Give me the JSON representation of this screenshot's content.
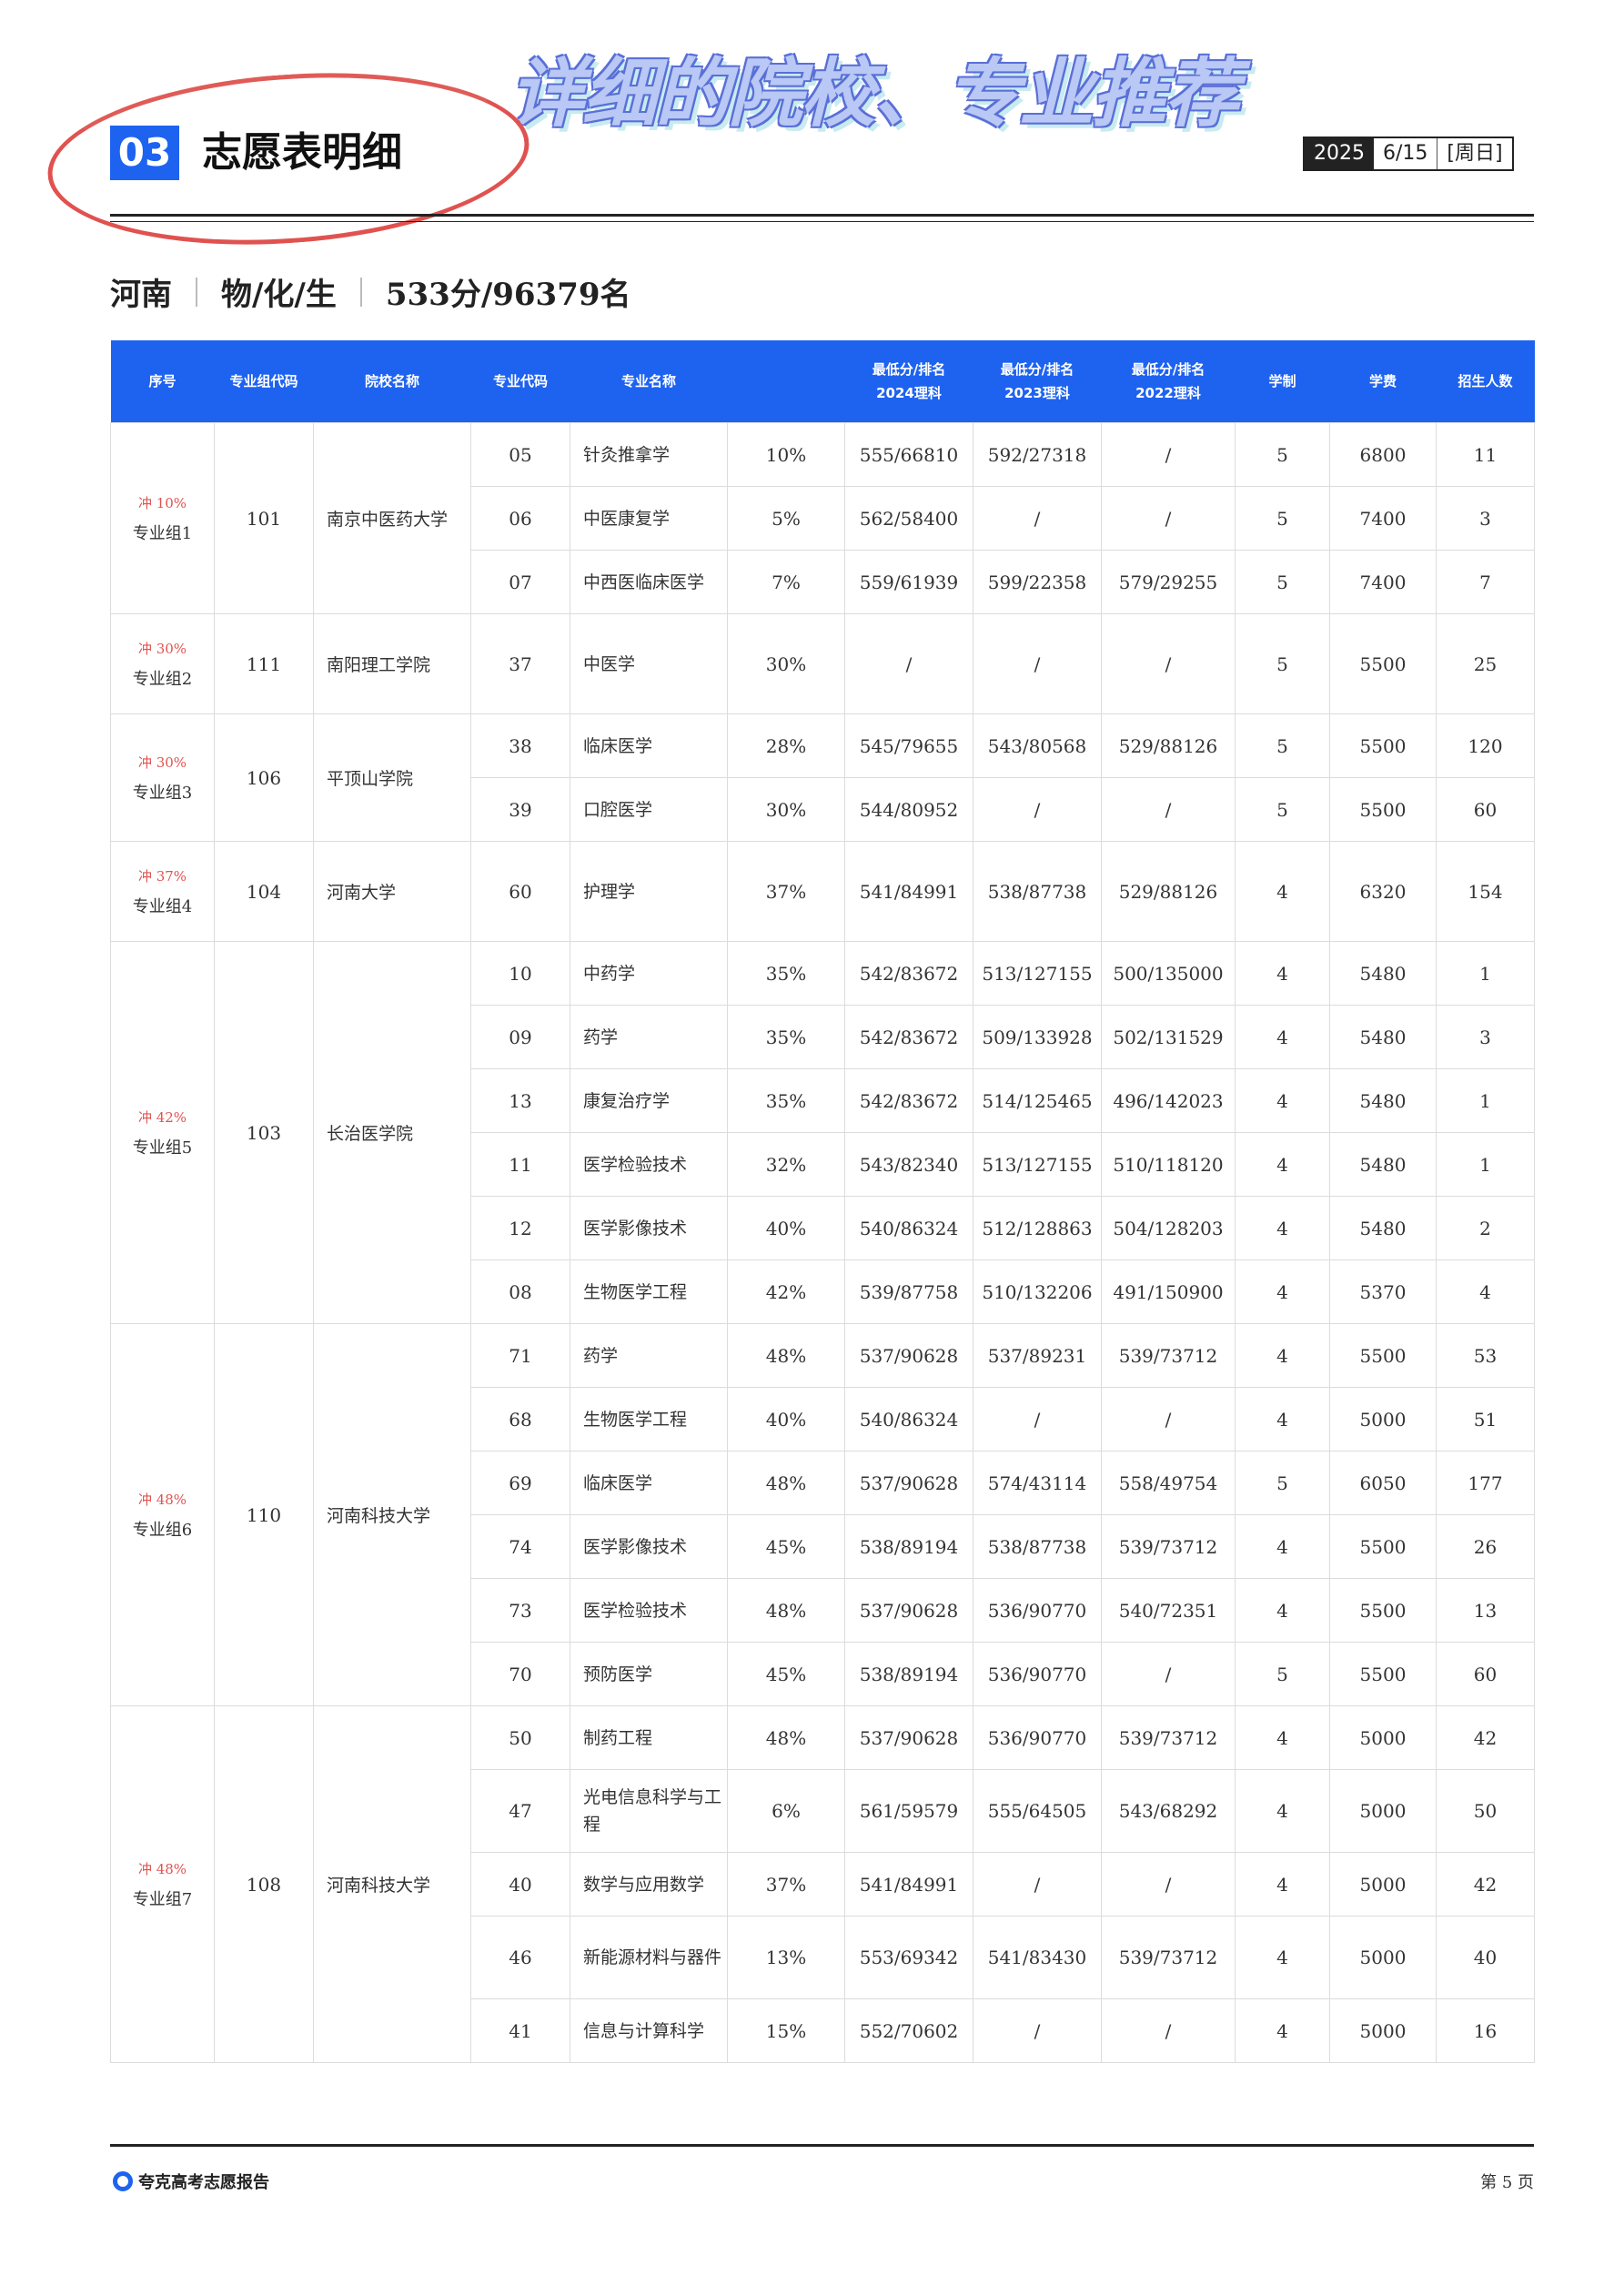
{
  "banner": "详细的院校、专业推荐",
  "section": {
    "number": "03",
    "title": "志愿表明细"
  },
  "date": {
    "year": "2025",
    "month_day": "6/15",
    "weekday": "[周日]"
  },
  "meta": {
    "province": "河南",
    "subjects": "物/化/生",
    "score_rank": "533分/96379名"
  },
  "table": {
    "headers": [
      "序号",
      "专业组代码",
      "院校名称",
      "专业代码",
      "专业名称",
      "",
      "最低分/排名\n2024理科",
      "最低分/排名\n2023理科",
      "最低分/排名\n2022理科",
      "学制",
      "学费",
      "招生人数"
    ],
    "groups": [
      {
        "tag": "冲 10%",
        "name": "专业组1",
        "code": "101",
        "school": "南京中医药大学",
        "rows": [
          [
            "05",
            "针灸推拿学",
            "10%",
            "555/66810",
            "592/27318",
            "/",
            "5",
            "6800",
            "11"
          ],
          [
            "06",
            "中医康复学",
            "5%",
            "562/58400",
            "/",
            "/",
            "5",
            "7400",
            "3"
          ],
          [
            "07",
            "中西医临床医学",
            "7%",
            "559/61939",
            "599/22358",
            "579/29255",
            "5",
            "7400",
            "7"
          ]
        ]
      },
      {
        "tag": "冲 30%",
        "name": "专业组2",
        "code": "111",
        "school": "南阳理工学院",
        "rows": [
          [
            "37",
            "中医学",
            "30%",
            "/",
            "/",
            "/",
            "5",
            "5500",
            "25"
          ]
        ]
      },
      {
        "tag": "冲 30%",
        "name": "专业组3",
        "code": "106",
        "school": "平顶山学院",
        "rows": [
          [
            "38",
            "临床医学",
            "28%",
            "545/79655",
            "543/80568",
            "529/88126",
            "5",
            "5500",
            "120"
          ],
          [
            "39",
            "口腔医学",
            "30%",
            "544/80952",
            "/",
            "/",
            "5",
            "5500",
            "60"
          ]
        ]
      },
      {
        "tag": "冲 37%",
        "name": "专业组4",
        "code": "104",
        "school": "河南大学",
        "rows": [
          [
            "60",
            "护理学",
            "37%",
            "541/84991",
            "538/87738",
            "529/88126",
            "4",
            "6320",
            "154"
          ]
        ]
      },
      {
        "tag": "冲 42%",
        "name": "专业组5",
        "code": "103",
        "school": "长治医学院",
        "rows": [
          [
            "10",
            "中药学",
            "35%",
            "542/83672",
            "513/127155",
            "500/135000",
            "4",
            "5480",
            "1"
          ],
          [
            "09",
            "药学",
            "35%",
            "542/83672",
            "509/133928",
            "502/131529",
            "4",
            "5480",
            "3"
          ],
          [
            "13",
            "康复治疗学",
            "35%",
            "542/83672",
            "514/125465",
            "496/142023",
            "4",
            "5480",
            "1"
          ],
          [
            "11",
            "医学检验技术",
            "32%",
            "543/82340",
            "513/127155",
            "510/118120",
            "4",
            "5480",
            "1"
          ],
          [
            "12",
            "医学影像技术",
            "40%",
            "540/86324",
            "512/128863",
            "504/128203",
            "4",
            "5480",
            "2"
          ],
          [
            "08",
            "生物医学工程",
            "42%",
            "539/87758",
            "510/132206",
            "491/150900",
            "4",
            "5370",
            "4"
          ]
        ]
      },
      {
        "tag": "冲 48%",
        "name": "专业组6",
        "code": "110",
        "school": "河南科技大学",
        "rows": [
          [
            "71",
            "药学",
            "48%",
            "537/90628",
            "537/89231",
            "539/73712",
            "4",
            "5500",
            "53"
          ],
          [
            "68",
            "生物医学工程",
            "40%",
            "540/86324",
            "/",
            "/",
            "4",
            "5000",
            "51"
          ],
          [
            "69",
            "临床医学",
            "48%",
            "537/90628",
            "574/43114",
            "558/49754",
            "5",
            "6050",
            "177"
          ],
          [
            "74",
            "医学影像技术",
            "45%",
            "538/89194",
            "538/87738",
            "539/73712",
            "4",
            "5500",
            "26"
          ],
          [
            "73",
            "医学检验技术",
            "48%",
            "537/90628",
            "536/90770",
            "540/72351",
            "4",
            "5500",
            "13"
          ],
          [
            "70",
            "预防医学",
            "45%",
            "538/89194",
            "536/90770",
            "/",
            "5",
            "5500",
            "60"
          ]
        ]
      },
      {
        "tag": "冲 48%",
        "name": "专业组7",
        "code": "108",
        "school": "河南科技大学",
        "rows": [
          [
            "50",
            "制药工程",
            "48%",
            "537/90628",
            "536/90770",
            "539/73712",
            "4",
            "5000",
            "42"
          ],
          [
            "47",
            "光电信息科学与工程",
            "6%",
            "561/59579",
            "555/64505",
            "543/68292",
            "4",
            "5000",
            "50"
          ],
          [
            "40",
            "数学与应用数学",
            "37%",
            "541/84991",
            "/",
            "/",
            "4",
            "5000",
            "42"
          ],
          [
            "46",
            "新能源材料与器件",
            "13%",
            "553/69342",
            "541/83430",
            "539/73712",
            "4",
            "5000",
            "40"
          ],
          [
            "41",
            "信息与计算科学",
            "15%",
            "552/70602",
            "/",
            "/",
            "4",
            "5000",
            "16"
          ]
        ]
      }
    ]
  },
  "footer": {
    "brand": "夸克高考志愿报告",
    "page": "第 5 页"
  }
}
